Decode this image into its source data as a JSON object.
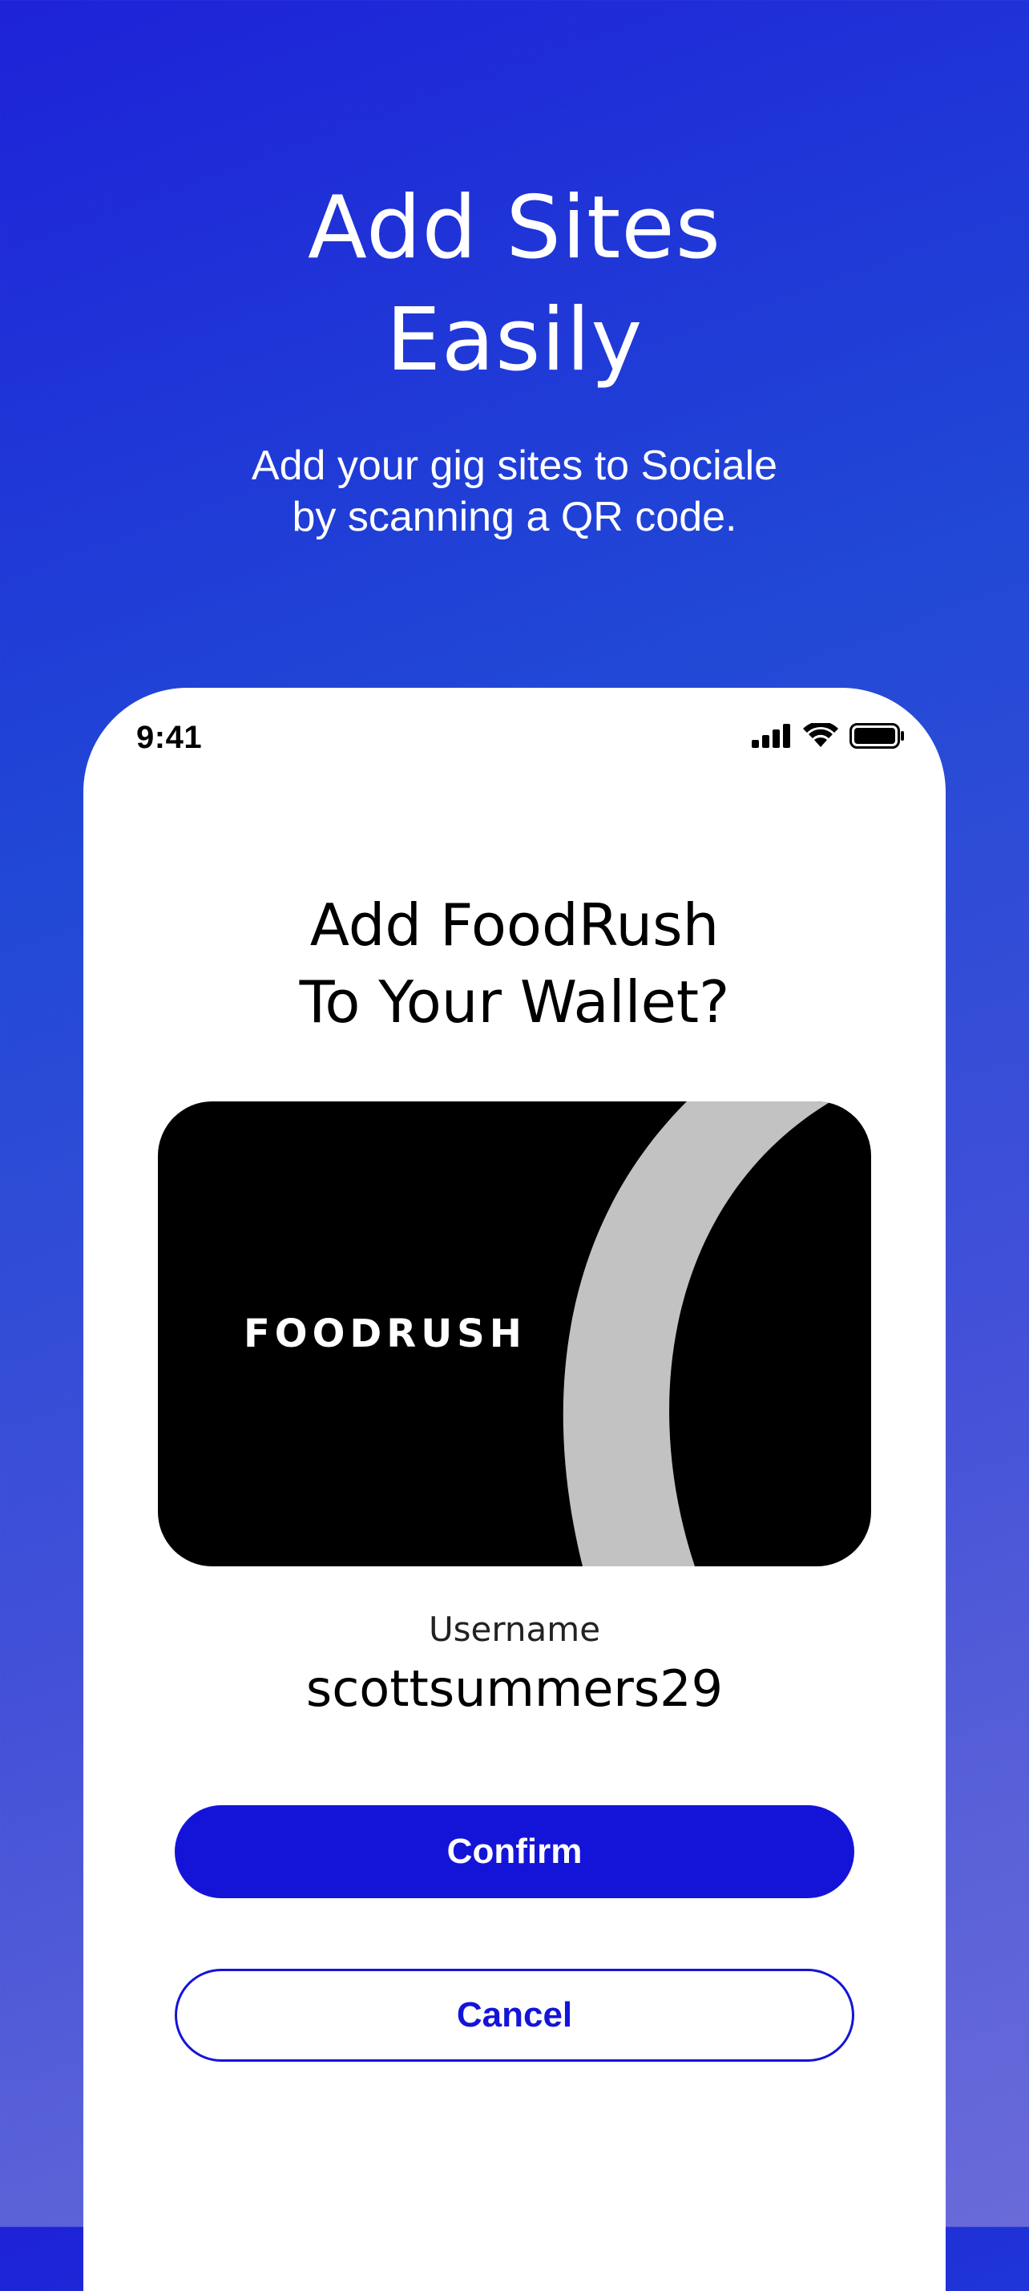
{
  "hero": {
    "title_line1": "Add Sites",
    "title_line2": "Easily",
    "subtitle_line1": "Add your gig sites to Sociale",
    "subtitle_line2": "by scanning a QR code."
  },
  "status_bar": {
    "time": "9:41",
    "icons": [
      "cellular-signal-icon",
      "wifi-icon",
      "battery-icon"
    ]
  },
  "dialog": {
    "title_line1": "Add FoodRush",
    "title_line2": "To Your Wallet?"
  },
  "card": {
    "brand": "FOODRUSH",
    "background_color": "#000000",
    "arc_color": "#c2c2c2"
  },
  "account": {
    "username_label": "Username",
    "username_value": "scottsummers29"
  },
  "actions": {
    "confirm_label": "Confirm",
    "cancel_label": "Cancel"
  },
  "colors": {
    "accent": "#1414d9",
    "gradient_top": "#1e22d8",
    "gradient_bottom": "#6a6ad9"
  }
}
